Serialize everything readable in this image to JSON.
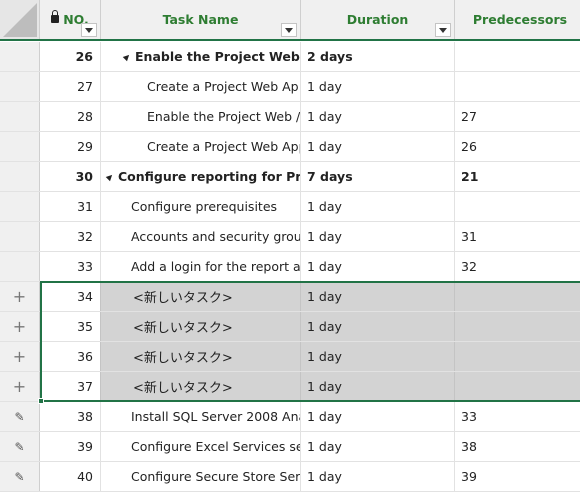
{
  "header": {
    "no": "NO.",
    "task": "Task Name",
    "duration": "Duration",
    "predecessors": "Predecessors"
  },
  "rows": [
    {
      "no": "26",
      "task": "Enable the Project Web A",
      "duration": "2 days",
      "pred": "",
      "summary": true,
      "indent": 1
    },
    {
      "no": "27",
      "task": "Create a Project Web Ap",
      "duration": "1 day",
      "pred": "",
      "indent": 2
    },
    {
      "no": "28",
      "task": "Enable the Project Web /",
      "duration": "1 day",
      "pred": "27",
      "indent": 2
    },
    {
      "no": "29",
      "task": "Create a Project Web App",
      "duration": "1 day",
      "pred": "26",
      "indent": 2
    },
    {
      "no": "30",
      "task": "Configure reporting for Proje",
      "duration": "7 days",
      "pred": "21",
      "summary": true,
      "indent": 0
    },
    {
      "no": "31",
      "task": "Configure prerequisites",
      "duration": "1 day",
      "pred": "",
      "indent": 1
    },
    {
      "no": "32",
      "task": "Accounts and security grou",
      "duration": "1 day",
      "pred": "31",
      "indent": 1
    },
    {
      "no": "33",
      "task": "Add a login for the report a",
      "duration": "1 day",
      "pred": "32",
      "indent": 1
    },
    {
      "no": "34",
      "task": "<新しいタスク>",
      "duration": "1 day",
      "pred": "",
      "new": true
    },
    {
      "no": "35",
      "task": "<新しいタスク>",
      "duration": "1 day",
      "pred": "",
      "new": true
    },
    {
      "no": "36",
      "task": "<新しいタスク>",
      "duration": "1 day",
      "pred": "",
      "new": true
    },
    {
      "no": "37",
      "task": "<新しいタスク>",
      "duration": "1 day",
      "pred": "",
      "new": true
    },
    {
      "no": "38",
      "task": "Install SQL Server 2008 Ana",
      "duration": "1 day",
      "pred": "33",
      "edit": true,
      "indent": 1
    },
    {
      "no": "39",
      "task": "Configure Excel Services set",
      "duration": "1 day",
      "pred": "38",
      "edit": true,
      "indent": 1
    },
    {
      "no": "40",
      "task": "Configure Secure Store Serv",
      "duration": "1 day",
      "pred": "39",
      "edit": true,
      "indent": 1
    }
  ],
  "icons": {
    "new_row": "plus-icon",
    "edit_row": "pencil-icon",
    "lock": "lock-icon",
    "filter": "filter-dropdown-icon"
  },
  "colors": {
    "accent": "#217346",
    "header_text": "#2e7d32",
    "new_row_fill": "#d3d3d3"
  }
}
